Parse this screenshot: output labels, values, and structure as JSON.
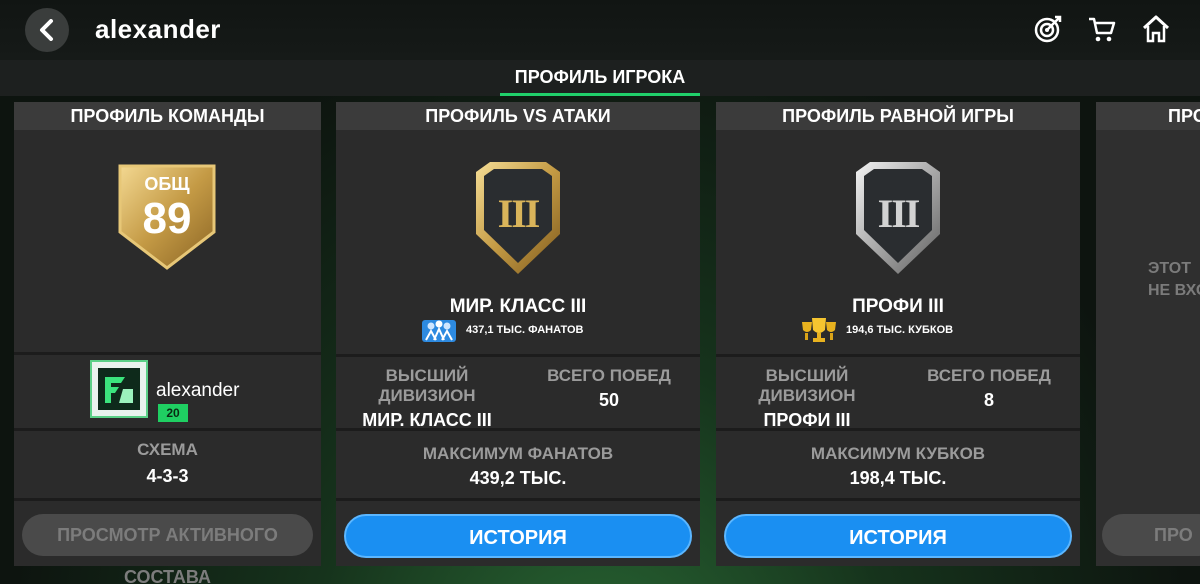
{
  "header": {
    "username": "alexander"
  },
  "tabs": [
    {
      "label": "ПРОФИЛЬ ИГРОКА"
    }
  ],
  "team_card": {
    "title": "ПРОФИЛЬ КОМАНДЫ",
    "ovr_label": "ОБЩ",
    "ovr_value": "89",
    "club_name": "alexander",
    "level": "20",
    "formation_label": "СХЕМА",
    "formation_value": "4-3-3",
    "button_label": "ПРОСМОТР АКТИВНОГО СОСТАВА"
  },
  "vs_attack_card": {
    "title": "ПРОФИЛЬ VS АТАКИ",
    "rank_numeral": "III",
    "rank": "МИР. КЛАСС III",
    "fans": "437,1 ТЫС. ФАНАТОВ",
    "best_div_label": "ВЫСШИЙ ДИВИЗИОН",
    "best_div_value": "МИР. КЛАСС III",
    "wins_label": "ВСЕГО ПОБЕД",
    "wins_value": "50",
    "max_label": "МАКСИМУМ ФАНАТОВ",
    "max_value": "439,2 ТЫС.",
    "button_label": "ИСТОРИЯ"
  },
  "h2h_card": {
    "title": "ПРОФИЛЬ РАВНОЙ ИГРЫ",
    "rank_numeral": "III",
    "rank": "ПРОФИ III",
    "trophies": "194,6 ТЫС. КУБКОВ",
    "best_div_label": "ВЫСШИЙ ДИВИЗИОН",
    "best_div_value": "ПРОФИ III",
    "wins_label": "ВСЕГО ПОБЕД",
    "wins_value": "8",
    "max_label": "МАКСИМУМ КУБКОВ",
    "max_value": "198,4 ТЫС.",
    "button_label": "ИСТОРИЯ"
  },
  "partial_card": {
    "title": "ПРО",
    "text_line1": "ЭТОТ",
    "text_line2": "НЕ ВХО",
    "button_label": "ПРО"
  },
  "colors": {
    "accent_green": "#20d06a",
    "button_blue": "#1a8ff2",
    "gold": "#d9b45a",
    "silver": "#c8c8c8"
  }
}
